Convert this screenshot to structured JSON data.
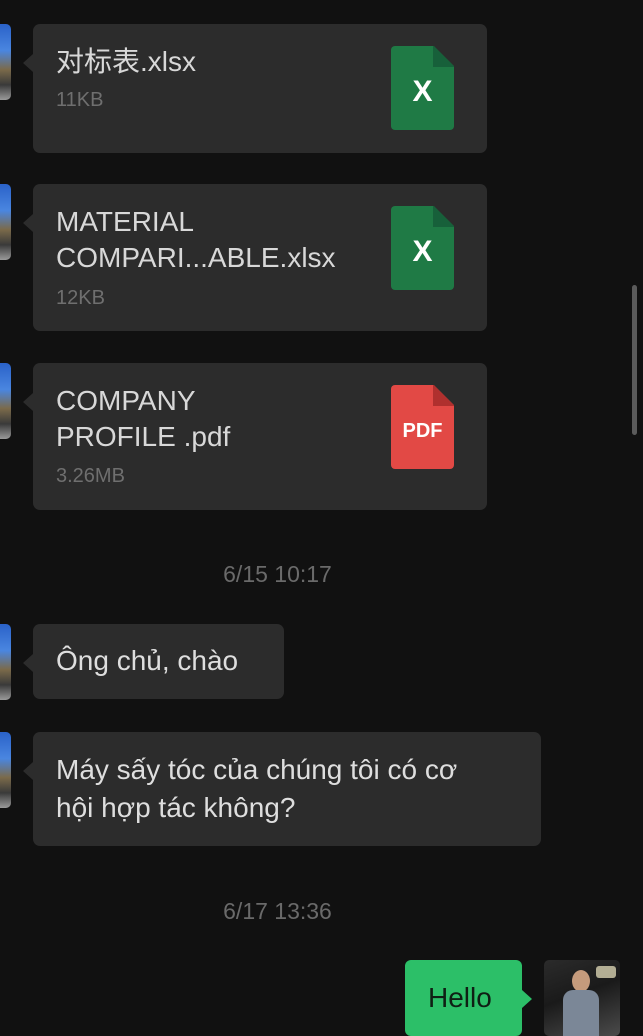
{
  "messages": {
    "files": [
      {
        "name": "对标表.xlsx",
        "size": "11KB",
        "type": "xlsx",
        "icon_label": "X",
        "icon": "excel-file-icon"
      },
      {
        "name": "MATERIAL\nCOMPARI...ABLE.xlsx",
        "size": "12KB",
        "type": "xlsx",
        "icon_label": "X",
        "icon": "excel-file-icon"
      },
      {
        "name": "COMPANY\nPROFILE .pdf",
        "size": "3.26MB",
        "type": "pdf",
        "icon_label": "PDF",
        "icon": "pdf-file-icon"
      }
    ],
    "timestamp_1": "6/15 10:17",
    "text_1": "Ông chủ, chào",
    "text_2": "Máy sấy tóc của chúng tôi có cơ\nhội hợp tác không?",
    "timestamp_2": "6/17 13:36",
    "sent_text": "Hello"
  },
  "colors": {
    "background": "#111111",
    "incoming_bubble": "#2c2c2c",
    "outgoing_bubble": "#2cbf68",
    "xlsx_icon": "#1f7a45",
    "pdf_icon": "#e24945"
  }
}
